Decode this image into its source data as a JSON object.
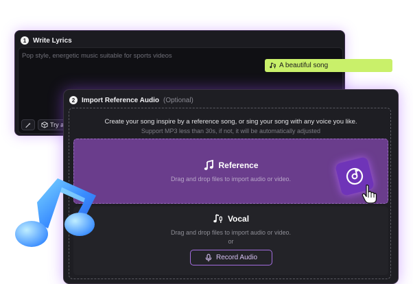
{
  "step1": {
    "number": "1",
    "title": "Write Lyrics",
    "placeholder": "Pop style, energetic music suitable for sports videos",
    "tool_try_label": "Try a"
  },
  "chip": {
    "icon": "music-mic-icon",
    "label": "A beautiful song"
  },
  "step2": {
    "number": "2",
    "title": "Import Reference Audio",
    "optional_label": "(Optional)",
    "description": "Create your song inspire by a reference song, or sing your song with any voice you like.",
    "support_text": "Support MP3 less than 30s, if not, it will be automatically adjusted",
    "reference": {
      "title": "Reference",
      "hint": "Drag and drop files to import audio or video.",
      "icon": "music-note-icon"
    },
    "vocal": {
      "title": "Vocal",
      "hint": "Drag and drop files to import audio or video.",
      "or_label": "or",
      "record_label": "Record Audio",
      "icon": "music-mic-icon"
    }
  },
  "colors": {
    "accent_purple": "#6a3d8c",
    "chip_green": "#c9f06a",
    "record_border": "#a46ee0",
    "panel_bg": "#1e1e23"
  }
}
